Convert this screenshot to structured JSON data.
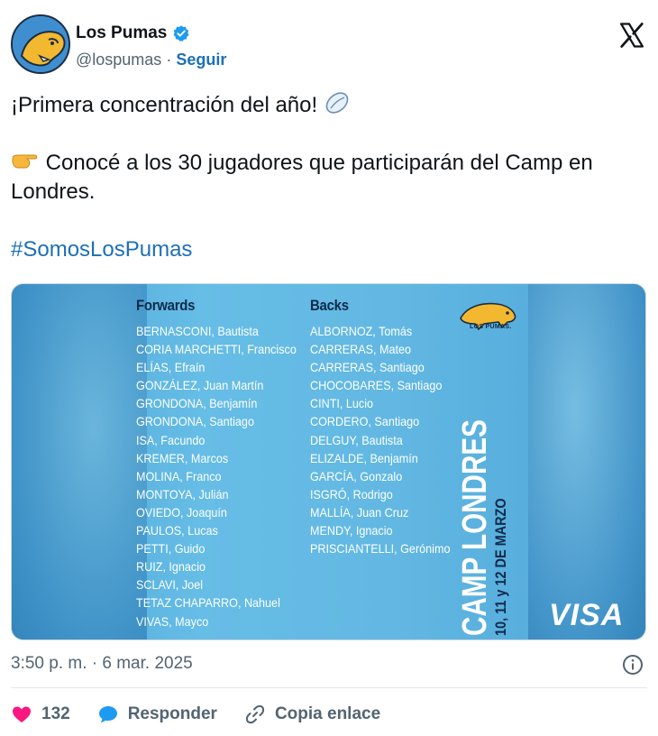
{
  "account": {
    "name": "Los Pumas",
    "handle": "@lospumas",
    "separator": "·",
    "follow_label": "Seguir"
  },
  "tweet": {
    "line1": "¡Primera concentración del año!",
    "line2": "Conocé a los 30 jugadores que participarán del Camp en Londres.",
    "hashtag": "#SomosLosPumas"
  },
  "media": {
    "forwards_title": "Forwards",
    "forwards": [
      "BERNASCONI, Bautista",
      "CORIA MARCHETTI, Francisco",
      "ELÍAS, Efraín",
      "GONZÁLEZ, Juan Martín",
      "GRONDONA, Benjamín",
      "GRONDONA, Santiago",
      "ISA, Facundo",
      "KREMER, Marcos",
      "MOLINA, Franco",
      "MONTOYA, Julián",
      "OVIEDO, Joaquín",
      "PAULOS, Lucas",
      "PETTI, Guido",
      "RUIZ, Ignacio",
      "SCLAVI, Joel",
      "TETAZ CHAPARRO, Nahuel",
      "VIVAS, Mayco"
    ],
    "backs_title": "Backs",
    "backs": [
      "ALBORNOZ, Tomás",
      "CARRERAS, Mateo",
      "CARRERAS, Santiago",
      "CHOCOBARES, Santiago",
      "CINTI, Lucio",
      "CORDERO, Santiago",
      "DELGUY, Bautista",
      "ELIZALDE, Benjamín",
      "GARCÍA, Gonzalo",
      "ISGRÓ, Rodrigo",
      "MALLÍA, Juan Cruz",
      "MENDY, Ignacio",
      "PRISCIANTELLI, Gerónimo"
    ],
    "logo_text": "LOS PUMAS.",
    "camp_title": "CAMP LONDRES",
    "camp_dates": "10, 11 y 12 DE MARZO",
    "sponsor": "VISA"
  },
  "meta": {
    "timestamp": "3:50 p. m. · 6 mar. 2025"
  },
  "actions": {
    "likes": "132",
    "reply_label": "Responder",
    "copy_label": "Copia enlace"
  },
  "colors": {
    "link_blue": "#1d6fb8",
    "like_pink": "#f91880",
    "reply_blue": "#1d9bf0",
    "secondary_text": "#536471"
  },
  "icons": [
    "pumas-avatar-icon",
    "verified-badge-icon",
    "x-logo-icon",
    "rugby-ball-emoji-icon",
    "pointing-hand-emoji-icon",
    "info-icon",
    "heart-icon",
    "reply-bubble-icon",
    "link-icon"
  ]
}
